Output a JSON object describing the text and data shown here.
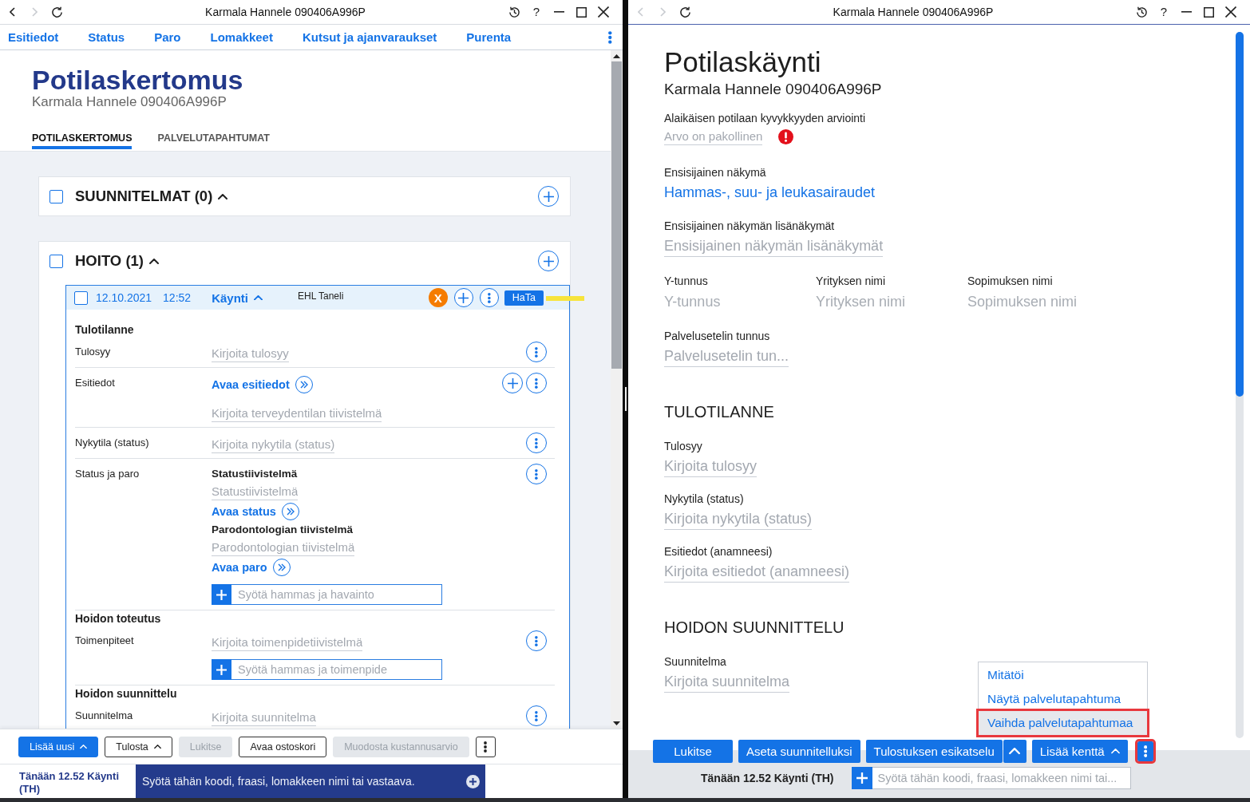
{
  "left_window": {
    "title": "Karmala Hannele 090406A996P",
    "nav_buttons": [
      {
        "kind": "back",
        "disabled": false
      },
      {
        "kind": "forward",
        "disabled": true
      },
      {
        "kind": "reload",
        "disabled": false
      }
    ],
    "help": "?",
    "menu": [
      "Esitiedot",
      "Status",
      "Paro",
      "Lomakkeet",
      "Kutsut ja ajanvaraukset",
      "Purenta"
    ],
    "heading": "Potilaskertomus",
    "patient": "Karmala Hannele 090406A996P",
    "tabs": [
      {
        "label": "POTILASKERTOMUS",
        "selected": true
      },
      {
        "label": "PALVELUTAPAHTUMAT",
        "selected": false
      }
    ],
    "sections": [
      {
        "title": "SUUNNITELMAT (0)",
        "checked": false,
        "expanded": true
      },
      {
        "title": "HOITO (1)",
        "checked": false,
        "expanded": true,
        "visits": [
          {
            "checked": false,
            "date": "12.10.2021",
            "time": "12:52",
            "type": "Käynti",
            "expanded": true,
            "author": "EHL Taneli",
            "alert": "X",
            "tag": "HaTa",
            "groups": [
              {
                "title": "Tulotilanne",
                "rows": [
                  {
                    "label": "Tulosyy",
                    "items": [
                      {
                        "kind": "field",
                        "placeholder": "Kirjoita tulosyy"
                      }
                    ],
                    "actions": [
                      {
                        "kind": "menu"
                      }
                    ]
                  },
                  {
                    "label": "Esitiedot",
                    "items": [
                      {
                        "kind": "link",
                        "text": "Avaa esitiedot"
                      },
                      {
                        "kind": "field",
                        "placeholder": "Kirjoita terveydentilan tiivistelmä"
                      }
                    ],
                    "actions": [
                      {
                        "kind": "add"
                      },
                      {
                        "kind": "menu"
                      }
                    ]
                  },
                  {
                    "label": "Nykytila (status)",
                    "items": [
                      {
                        "kind": "field",
                        "placeholder": "Kirjoita nykytila (status)"
                      }
                    ],
                    "actions": [
                      {
                        "kind": "menu"
                      }
                    ]
                  },
                  {
                    "label": "Status ja paro",
                    "items": [
                      {
                        "kind": "subheading",
                        "text": "Statustiivistelmä"
                      },
                      {
                        "kind": "field",
                        "placeholder": "Statustiivistelmä"
                      },
                      {
                        "kind": "link",
                        "text": "Avaa status"
                      },
                      {
                        "kind": "subheading",
                        "text": "Parodontologian tiivistelmä"
                      },
                      {
                        "kind": "field",
                        "placeholder": "Parodontologian tiivistelmä"
                      },
                      {
                        "kind": "link",
                        "text": "Avaa paro"
                      },
                      {
                        "kind": "entry",
                        "placeholder": "Syötä hammas ja havainto"
                      }
                    ],
                    "actions": [
                      {
                        "kind": "menu"
                      }
                    ]
                  }
                ]
              },
              {
                "title": "Hoidon toteutus",
                "rows": [
                  {
                    "label": "Toimenpiteet",
                    "items": [
                      {
                        "kind": "field",
                        "placeholder": "Kirjoita toimenpidetiivistelmä"
                      },
                      {
                        "kind": "entry",
                        "placeholder": "Syötä hammas ja toimenpide"
                      }
                    ],
                    "actions": [
                      {
                        "kind": "menu"
                      }
                    ]
                  }
                ]
              },
              {
                "title": "Hoidon suunnittelu",
                "rows": [
                  {
                    "label": "Suunnitelma",
                    "items": [
                      {
                        "kind": "field",
                        "placeholder": "Kirjoita suunnitelma"
                      }
                    ],
                    "actions": [
                      {
                        "kind": "menu"
                      }
                    ]
                  }
                ]
              }
            ]
          }
        ]
      }
    ],
    "toolbar": [
      {
        "kind": "primary",
        "label": "Lisää uusi",
        "dropdown": true,
        "disabled": false
      },
      {
        "kind": "secondary",
        "label": "Tulosta",
        "dropdown": true,
        "disabled": false
      },
      {
        "kind": "secondary",
        "label": "Lukitse",
        "dropdown": false,
        "disabled": true
      },
      {
        "kind": "secondary",
        "label": "Avaa ostoskori",
        "dropdown": false,
        "disabled": false
      },
      {
        "kind": "secondary",
        "label": "Muodosta kustannusarvio",
        "dropdown": false,
        "disabled": true
      },
      {
        "kind": "menu",
        "disabled": false
      }
    ],
    "status_bar": {
      "context": "Tänään 12.52 Käynti (TH)",
      "command_placeholder": "Syötä tähän koodi, fraasi, lomakkeen nimi tai vastaava."
    }
  },
  "right_window": {
    "title": "Karmala Hannele 090406A996P",
    "nav_buttons": [
      {
        "kind": "back",
        "disabled": true
      },
      {
        "kind": "forward",
        "disabled": true
      },
      {
        "kind": "reload",
        "disabled": false
      }
    ],
    "help": "?",
    "heading": "Potilaskäynti",
    "patient": "Karmala Hannele 090406A996P",
    "fields": [
      {
        "kind": "required",
        "label": "Alaikäisen potilaan kyvykkyyden arviointi",
        "placeholder": "Arvo on pakollinen",
        "error": true
      },
      {
        "kind": "value",
        "label": "Ensisijainen näkymä",
        "value": "Hammas-, suu- ja leukasairaudet"
      },
      {
        "kind": "text",
        "label": "Ensisijainen näkymän lisänäkymät",
        "placeholder": "Ensisijainen näkymän lisänäkymät"
      },
      {
        "kind": "columns",
        "columns": [
          {
            "label": "Y-tunnus",
            "placeholder": "Y-tunnus"
          },
          {
            "label": "Yrityksen nimi",
            "placeholder": "Yrityksen nimi"
          },
          {
            "label": "Sopimuksen nimi",
            "placeholder": "Sopimuksen nimi"
          }
        ]
      },
      {
        "kind": "text",
        "label": "Palvelusetelin tunnus",
        "placeholder": "Palvelusetelin tun..."
      }
    ],
    "sections": [
      {
        "title": "TULOTILANNE",
        "fields": [
          {
            "kind": "text",
            "label": "Tulosyy",
            "placeholder": "Kirjoita tulosyy"
          },
          {
            "kind": "text",
            "label": "Nykytila (status)",
            "placeholder": "Kirjoita nykytila (status)"
          },
          {
            "kind": "text",
            "label": "Esitiedot (anamneesi)",
            "placeholder": "Kirjoita esitiedot (anamneesi)"
          }
        ]
      },
      {
        "title": "HOIDON SUUNNITTELU",
        "fields": [
          {
            "kind": "text",
            "label": "Suunnitelma",
            "placeholder": "Kirjoita suunnitelma"
          }
        ]
      }
    ],
    "menu": {
      "items": [
        {
          "label": "Mitätöi",
          "selected": false,
          "outlined": false
        },
        {
          "label": "Näytä palvelutapahtuma",
          "selected": false,
          "outlined": false
        },
        {
          "label": "Vaihda palvelutapahtumaa",
          "selected": true,
          "outlined": true
        }
      ]
    },
    "toolbar": [
      {
        "kind": "primary",
        "label": "Lukitse",
        "dropdown": false,
        "outlined": false
      },
      {
        "kind": "primary",
        "label": "Aseta suunnitelluksi",
        "dropdown": false,
        "outlined": false
      },
      {
        "kind": "split",
        "label": "Tulostuksen esikatselu",
        "dropdown": false,
        "outlined": false
      },
      {
        "kind": "primary",
        "label": "Lisää kenttä",
        "dropdown": true,
        "outlined": false
      },
      {
        "kind": "menu",
        "outlined": true
      }
    ],
    "status_bar": {
      "context": "Tänään 12.52 Käynti (TH)",
      "command_placeholder": "Syötä tähän koodi, fraasi, lomakkeen nimi tai..."
    }
  }
}
